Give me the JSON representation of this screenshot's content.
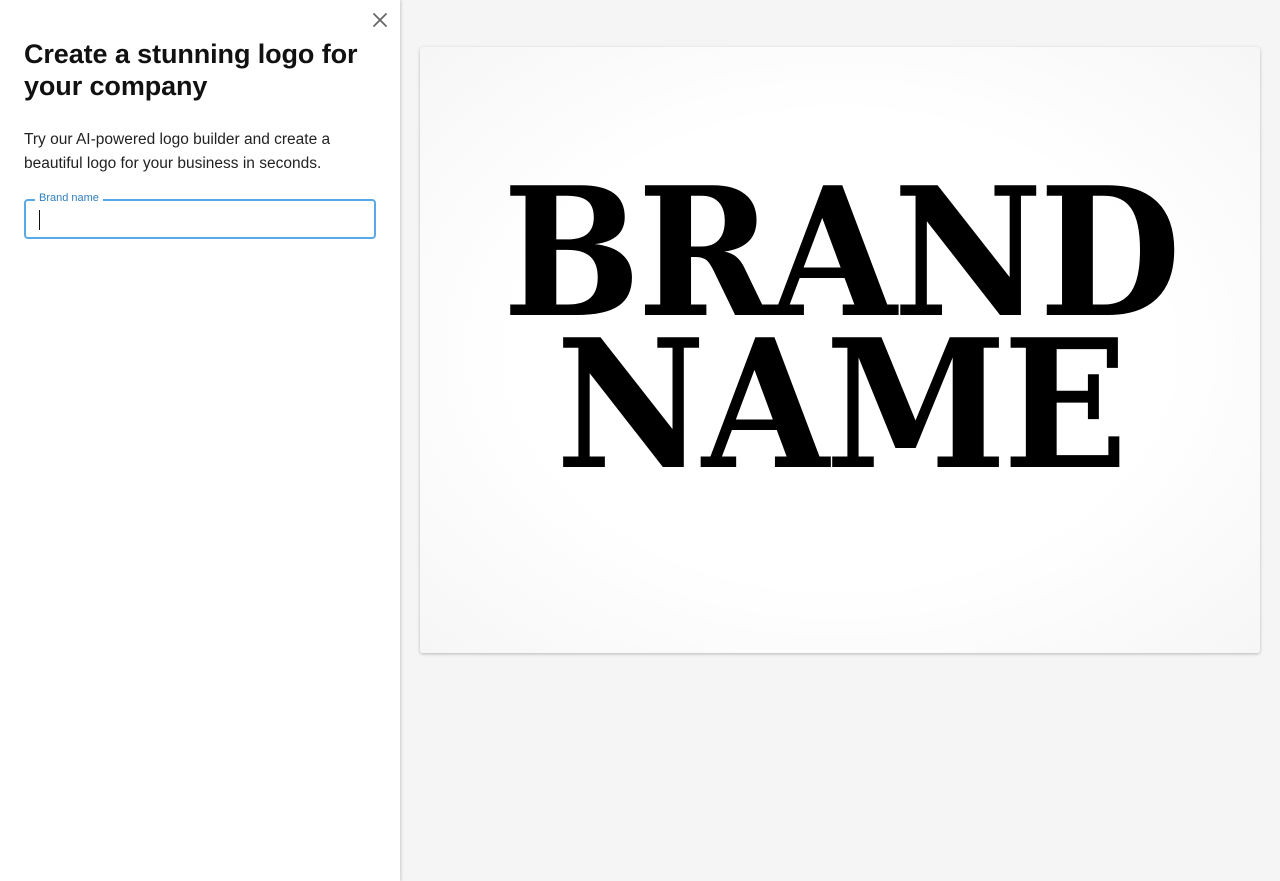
{
  "sidebar": {
    "title": "Create a stunning logo for your company",
    "subtitle": "Try our AI-powered logo builder and create a beautiful logo for your business in seconds.",
    "brand_field": {
      "label": "Brand name",
      "value": "",
      "placeholder": ""
    },
    "close_icon": "close-icon"
  },
  "preview": {
    "logo_line1": "BRAND",
    "logo_line2": "NAME"
  },
  "colors": {
    "accent": "#5aa9e6",
    "label": "#2f7fc1",
    "background": "#f5f5f5",
    "panel": "#ffffff",
    "text": "#111111"
  }
}
